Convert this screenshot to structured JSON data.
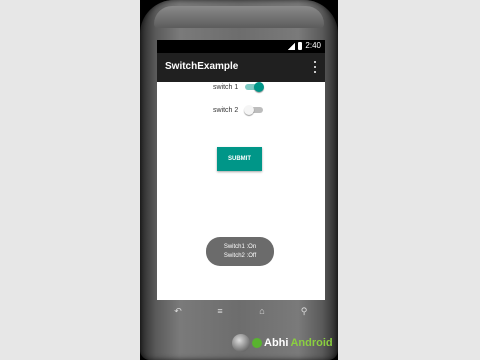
{
  "status_bar": {
    "time": "2:40"
  },
  "app_bar": {
    "title": "SwitchExample"
  },
  "switches": [
    {
      "label": "switch 1",
      "checked": true
    },
    {
      "label": "switch 2",
      "checked": false
    }
  ],
  "submit_button": {
    "label": "SUBMIT"
  },
  "toast": {
    "line1": "Switch1 :On",
    "line2": "Switch2 :Off"
  },
  "watermark": {
    "prefix": "Abhi",
    "suffix": "Android"
  },
  "colors": {
    "accent": "#009688",
    "app_bar": "#202020",
    "switch_off_thumb": "#f5f5f5",
    "switch_off_track": "#bdbdbd",
    "toast_bg": "#6b6b6b"
  },
  "icons": {
    "signal": "signal-icon",
    "battery": "battery-icon",
    "overflow": "overflow-menu-icon",
    "back": "back-icon",
    "menu": "menu-icon",
    "home": "home-icon",
    "search": "search-icon"
  }
}
